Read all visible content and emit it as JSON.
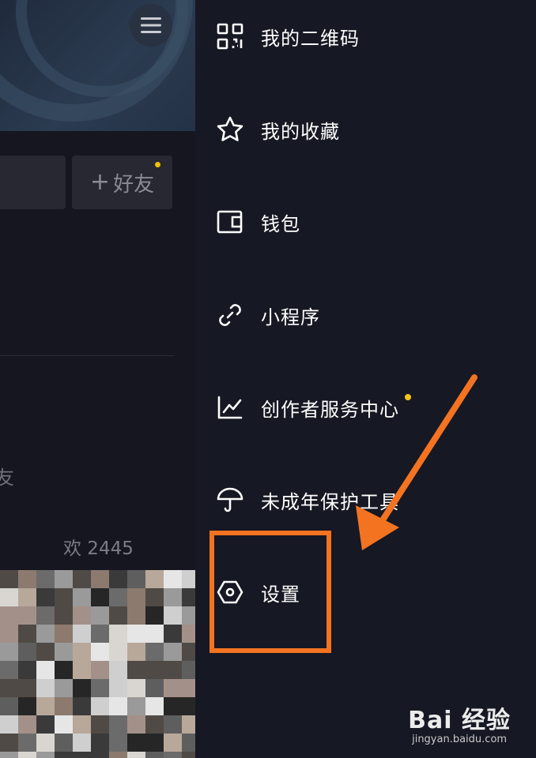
{
  "colors": {
    "drawer_bg": "#161823",
    "accent_dot": "#f5c518",
    "annotation": "#f47321"
  },
  "left": {
    "add_friend_label": "好友",
    "friends_fragment": "友",
    "likes_fragment": "欢 2445"
  },
  "drawer": {
    "items": [
      {
        "label": "我的二维码",
        "icon": "qr-code-icon"
      },
      {
        "label": "我的收藏",
        "icon": "star-icon"
      },
      {
        "label": "钱包",
        "icon": "wallet-icon"
      },
      {
        "label": "小程序",
        "icon": "link-icon"
      },
      {
        "label": "创作者服务中心",
        "icon": "chart-icon",
        "has_dot": true
      },
      {
        "label": "未成年保护工具",
        "icon": "umbrella-icon"
      },
      {
        "label": "设置",
        "icon": "settings-icon"
      }
    ]
  },
  "watermark": {
    "brand": "Bai 经验",
    "url": "jingyan.baidu.com"
  }
}
